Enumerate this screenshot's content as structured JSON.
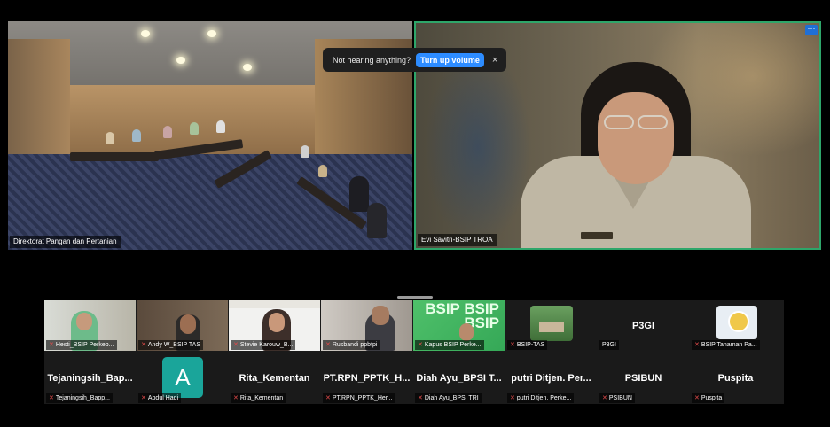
{
  "main": {
    "left_tile": {
      "name": "Direktorat Pangan dan Pertanian"
    },
    "right_tile": {
      "name": "Evi Savitri-BSIP TROA",
      "more_label": "···"
    }
  },
  "toast": {
    "message": "Not hearing anything?",
    "button": "Turn up volume",
    "close": "×"
  },
  "gallery": {
    "row1": [
      {
        "name": "Hesti_BSIP Perkeb...",
        "muted": true,
        "kind": "video"
      },
      {
        "name": "Andy W_BSIP TAS",
        "muted": true,
        "kind": "video"
      },
      {
        "name": "Stevie Karouw_B...",
        "muted": true,
        "kind": "video"
      },
      {
        "name": "Rusbandi ppbtpi",
        "muted": true,
        "kind": "video"
      },
      {
        "name": "Kapus BSIP Perke...",
        "muted": true,
        "kind": "video"
      },
      {
        "name": "BSIP-TAS",
        "muted": true,
        "kind": "thumb"
      },
      {
        "name": "P3GI",
        "display": "P3GI",
        "muted": false,
        "kind": "name"
      },
      {
        "name": "BSIP Tanaman Pa...",
        "muted": true,
        "kind": "logo"
      }
    ],
    "row2": [
      {
        "name": "Tejaningsih_Bapp...",
        "display": "Tejaningsih_Bap...",
        "muted": true,
        "kind": "name"
      },
      {
        "name": "Abdul Hadi",
        "initial": "A",
        "muted": true,
        "kind": "avatar"
      },
      {
        "name": "Rita_Kementan",
        "display": "Rita_Kementan",
        "muted": true,
        "kind": "name"
      },
      {
        "name": "PT.RPN_PPTK_Her...",
        "display": "PT.RPN_PPTK_H...",
        "muted": true,
        "kind": "name"
      },
      {
        "name": "Diah Ayu_BPSI TRI",
        "display": "Diah Ayu_BPSI T...",
        "muted": true,
        "kind": "name"
      },
      {
        "name": "putri Ditjen. Perke...",
        "display": "putri Ditjen. Per...",
        "muted": true,
        "kind": "name"
      },
      {
        "name": "PSIBUN",
        "display": "PSIBUN",
        "muted": true,
        "kind": "name"
      },
      {
        "name": "Puspita",
        "display": "Puspita",
        "muted": true,
        "kind": "name"
      }
    ],
    "green_tile_text": "BSIP BSIP BSIP"
  },
  "colors": {
    "active_speaker_border": "#2ea66a",
    "toast_button": "#2d8cff",
    "avatar_a": "#1aa59a",
    "muted_icon": "#e24a4a"
  }
}
